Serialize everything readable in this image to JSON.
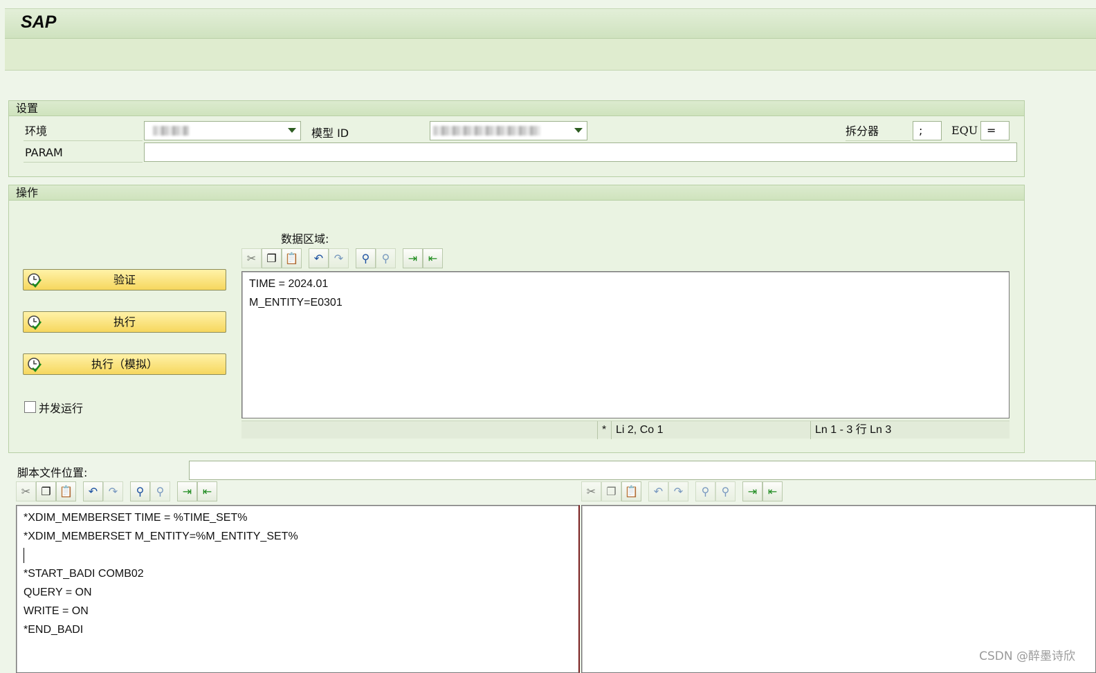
{
  "app": {
    "logo": "SAP"
  },
  "settings": {
    "title": "设置",
    "env_label": "环境",
    "model_label": "模型 ID",
    "splitter_label": "拆分器",
    "splitter_value": ";",
    "equ_label": "EQU",
    "equ_value": "=",
    "param_label": "PARAM",
    "param_value": ""
  },
  "operations": {
    "title": "操作",
    "validate_label": "验证",
    "execute_label": "执行",
    "simulate_label": "执行（模拟）",
    "parallel_label": "并发运行",
    "data_region_label": "数据区域:"
  },
  "data_editor": {
    "lines": [
      "TIME = 2024.01",
      "M_ENTITY=E0301"
    ],
    "status_marker": "*",
    "status_pos": "Li 2, Co 1",
    "status_range": "Ln 1 - 3 行 Ln 3"
  },
  "script": {
    "path_label": "脚本文件位置:",
    "path_value": "",
    "lines": [
      "*XDIM_MEMBERSET TIME = %TIME_SET%",
      "*XDIM_MEMBERSET M_ENTITY=%M_ENTITY_SET%",
      "",
      "*START_BADI COMB02",
      "QUERY = ON",
      "WRITE = ON",
      "*END_BADI"
    ]
  },
  "toolbar_icons": [
    "cut-icon",
    "copy-icon",
    "paste-icon",
    "undo-icon",
    "redo-icon",
    "find-icon",
    "find-next-icon",
    "import-icon",
    "export-icon"
  ],
  "watermark": "CSDN @醉墨诗欣",
  "colors": {
    "background": "#eef5e9",
    "header_green": "#cfe2bf",
    "button_yellow": "#f6d75e",
    "accent_green": "#2e5d22"
  }
}
